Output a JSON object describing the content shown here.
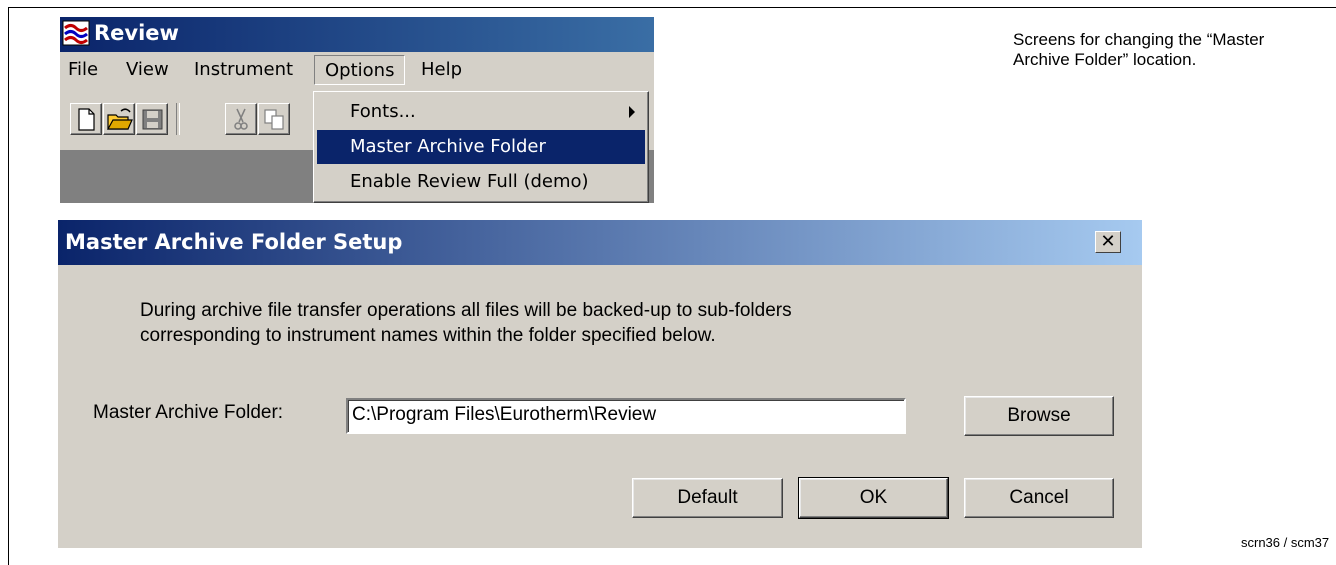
{
  "app": {
    "title": "Review",
    "menu": [
      "File",
      "View",
      "Instrument",
      "Options",
      "Help"
    ],
    "options_menu": {
      "items": [
        {
          "label": "Fonts...",
          "has_submenu": true
        },
        {
          "label": "Master Archive Folder",
          "highlighted": true
        },
        {
          "label": "Enable Review Full (demo)"
        }
      ]
    },
    "toolbar_icons": [
      "new-icon",
      "open-icon",
      "save-icon",
      "cut-icon",
      "copy-icon"
    ]
  },
  "dialog": {
    "title": "Master Archive Folder Setup",
    "close_glyph": "✕",
    "description_line1": "During archive file transfer operations all files will be backed-up to sub-folders",
    "description_line2": "corresponding to instrument names within the folder specified below.",
    "folder_label": "Master Archive Folder:",
    "folder_value": "C:\\Program Files\\Eurotherm\\Review",
    "browse_label": "Browse",
    "default_label": "Default",
    "ok_label": "OK",
    "cancel_label": "Cancel"
  },
  "caption": {
    "line1": "Screens for changing the “Master",
    "line2": "Archive Folder” location."
  },
  "reference": "scrn36 / scm37",
  "colors": {
    "titlebar_dark": "#0a246a",
    "dialog_title_light": "#a6caf0",
    "window_face": "#d4d0c8",
    "highlight": "#0a246a"
  }
}
